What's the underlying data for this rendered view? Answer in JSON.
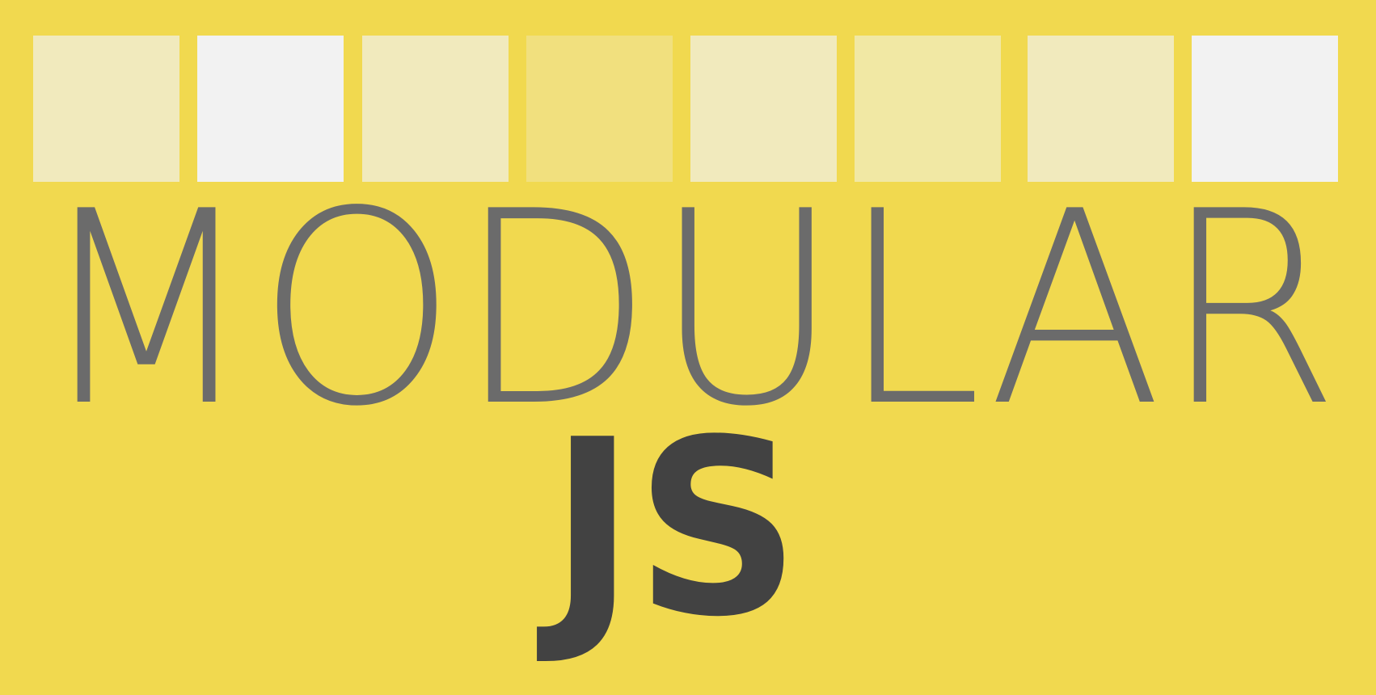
{
  "banner": {
    "top_word": "MODULAR",
    "bottom_word": "JS"
  },
  "colors": {
    "background": "#F1D94F",
    "top_word": "#6B6B6B",
    "bottom_word": "#424242",
    "tiles": [
      "#F1EABD",
      "#F2F2F2",
      "#F1EABD",
      "#F1E07E",
      "#F1EABD",
      "#F1E8A4",
      "#F1EABD",
      "#F2F2F2"
    ]
  }
}
